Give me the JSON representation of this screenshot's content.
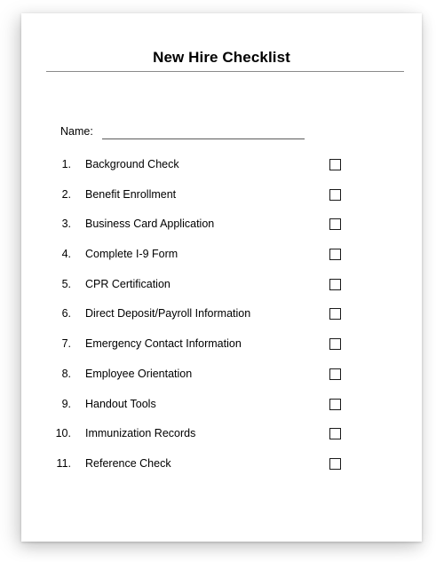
{
  "document": {
    "title": "New Hire Checklist",
    "name_field": {
      "label": "Name:",
      "value": "",
      "placeholder": ""
    },
    "checklist": [
      {
        "number": "1.",
        "label": "Background Check",
        "checked": false,
        "checkbox_icon": "checkbox-empty-icon"
      },
      {
        "number": "2.",
        "label": "Benefit Enrollment",
        "checked": false,
        "checkbox_icon": "checkbox-empty-icon"
      },
      {
        "number": "3.",
        "label": "Business Card Application",
        "checked": false,
        "checkbox_icon": "checkbox-empty-icon"
      },
      {
        "number": "4.",
        "label": "Complete I-9 Form",
        "checked": false,
        "checkbox_icon": "checkbox-empty-icon"
      },
      {
        "number": "5.",
        "label": "CPR Certification",
        "checked": false,
        "checkbox_icon": "checkbox-empty-icon"
      },
      {
        "number": "6.",
        "label": "Direct Deposit/Payroll Information",
        "checked": false,
        "checkbox_icon": "checkbox-empty-icon"
      },
      {
        "number": "7.",
        "label": "Emergency Contact Information",
        "checked": false,
        "checkbox_icon": "checkbox-empty-icon"
      },
      {
        "number": "8.",
        "label": "Employee Orientation",
        "checked": false,
        "checkbox_icon": "checkbox-empty-icon"
      },
      {
        "number": "9.",
        "label": "Handout Tools",
        "checked": false,
        "checkbox_icon": "checkbox-empty-icon"
      },
      {
        "number": "10.",
        "label": "Immunization Records",
        "checked": false,
        "checkbox_icon": "checkbox-empty-icon"
      },
      {
        "number": "11.",
        "label": "Reference Check",
        "checked": false,
        "checkbox_icon": "checkbox-empty-icon"
      }
    ]
  },
  "colors": {
    "page_background": "#ffffff",
    "canvas_background": "#ffffff",
    "text": "#000000",
    "title_rule": "#8a8a8a",
    "name_rule": "#5a5a5a",
    "checkbox_border": "#1a1a1a"
  }
}
